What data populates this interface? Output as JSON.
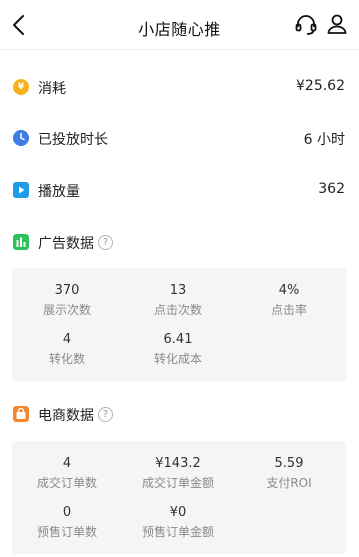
{
  "header": {
    "title": "小店随心推"
  },
  "summary": {
    "cost_label": "消耗",
    "cost_value": "¥25.62",
    "cost_icon_glyph": "¥",
    "duration_label": "已投放时长",
    "duration_value": "6 小时",
    "plays_label": "播放量",
    "plays_value": "362"
  },
  "ad_data": {
    "title": "广告数据",
    "help_glyph": "?",
    "metrics": [
      {
        "value": "370",
        "label": "展示次数"
      },
      {
        "value": "13",
        "label": "点击次数"
      },
      {
        "value": "4%",
        "label": "点击率"
      },
      {
        "value": "4",
        "label": "转化数"
      },
      {
        "value": "6.41",
        "label": "转化成本"
      }
    ]
  },
  "ecom_data": {
    "title": "电商数据",
    "help_glyph": "?",
    "metrics": [
      {
        "value": "4",
        "label": "成交订单数"
      },
      {
        "value": "¥143.2",
        "label": "成交订单金额"
      },
      {
        "value": "5.59",
        "label": "支付ROI"
      },
      {
        "value": "0",
        "label": "预售订单数"
      },
      {
        "value": "¥0",
        "label": "预售订单金额"
      }
    ]
  },
  "icons": {
    "back": "chevron-left-icon",
    "support": "headset-icon",
    "user": "user-icon",
    "cost": "yuan-coin-icon",
    "duration": "clock-icon",
    "plays": "play-icon",
    "ad_section": "bar-chart-icon",
    "ecom_section": "shopping-bag-icon"
  },
  "colors": {
    "coin": "#f5b21b",
    "clock": "#3f7de6",
    "play": "#1f9be8",
    "ad_section": "#2fc25b",
    "ecom_section": "#f5862b",
    "card_bg": "#f5f5f5"
  }
}
